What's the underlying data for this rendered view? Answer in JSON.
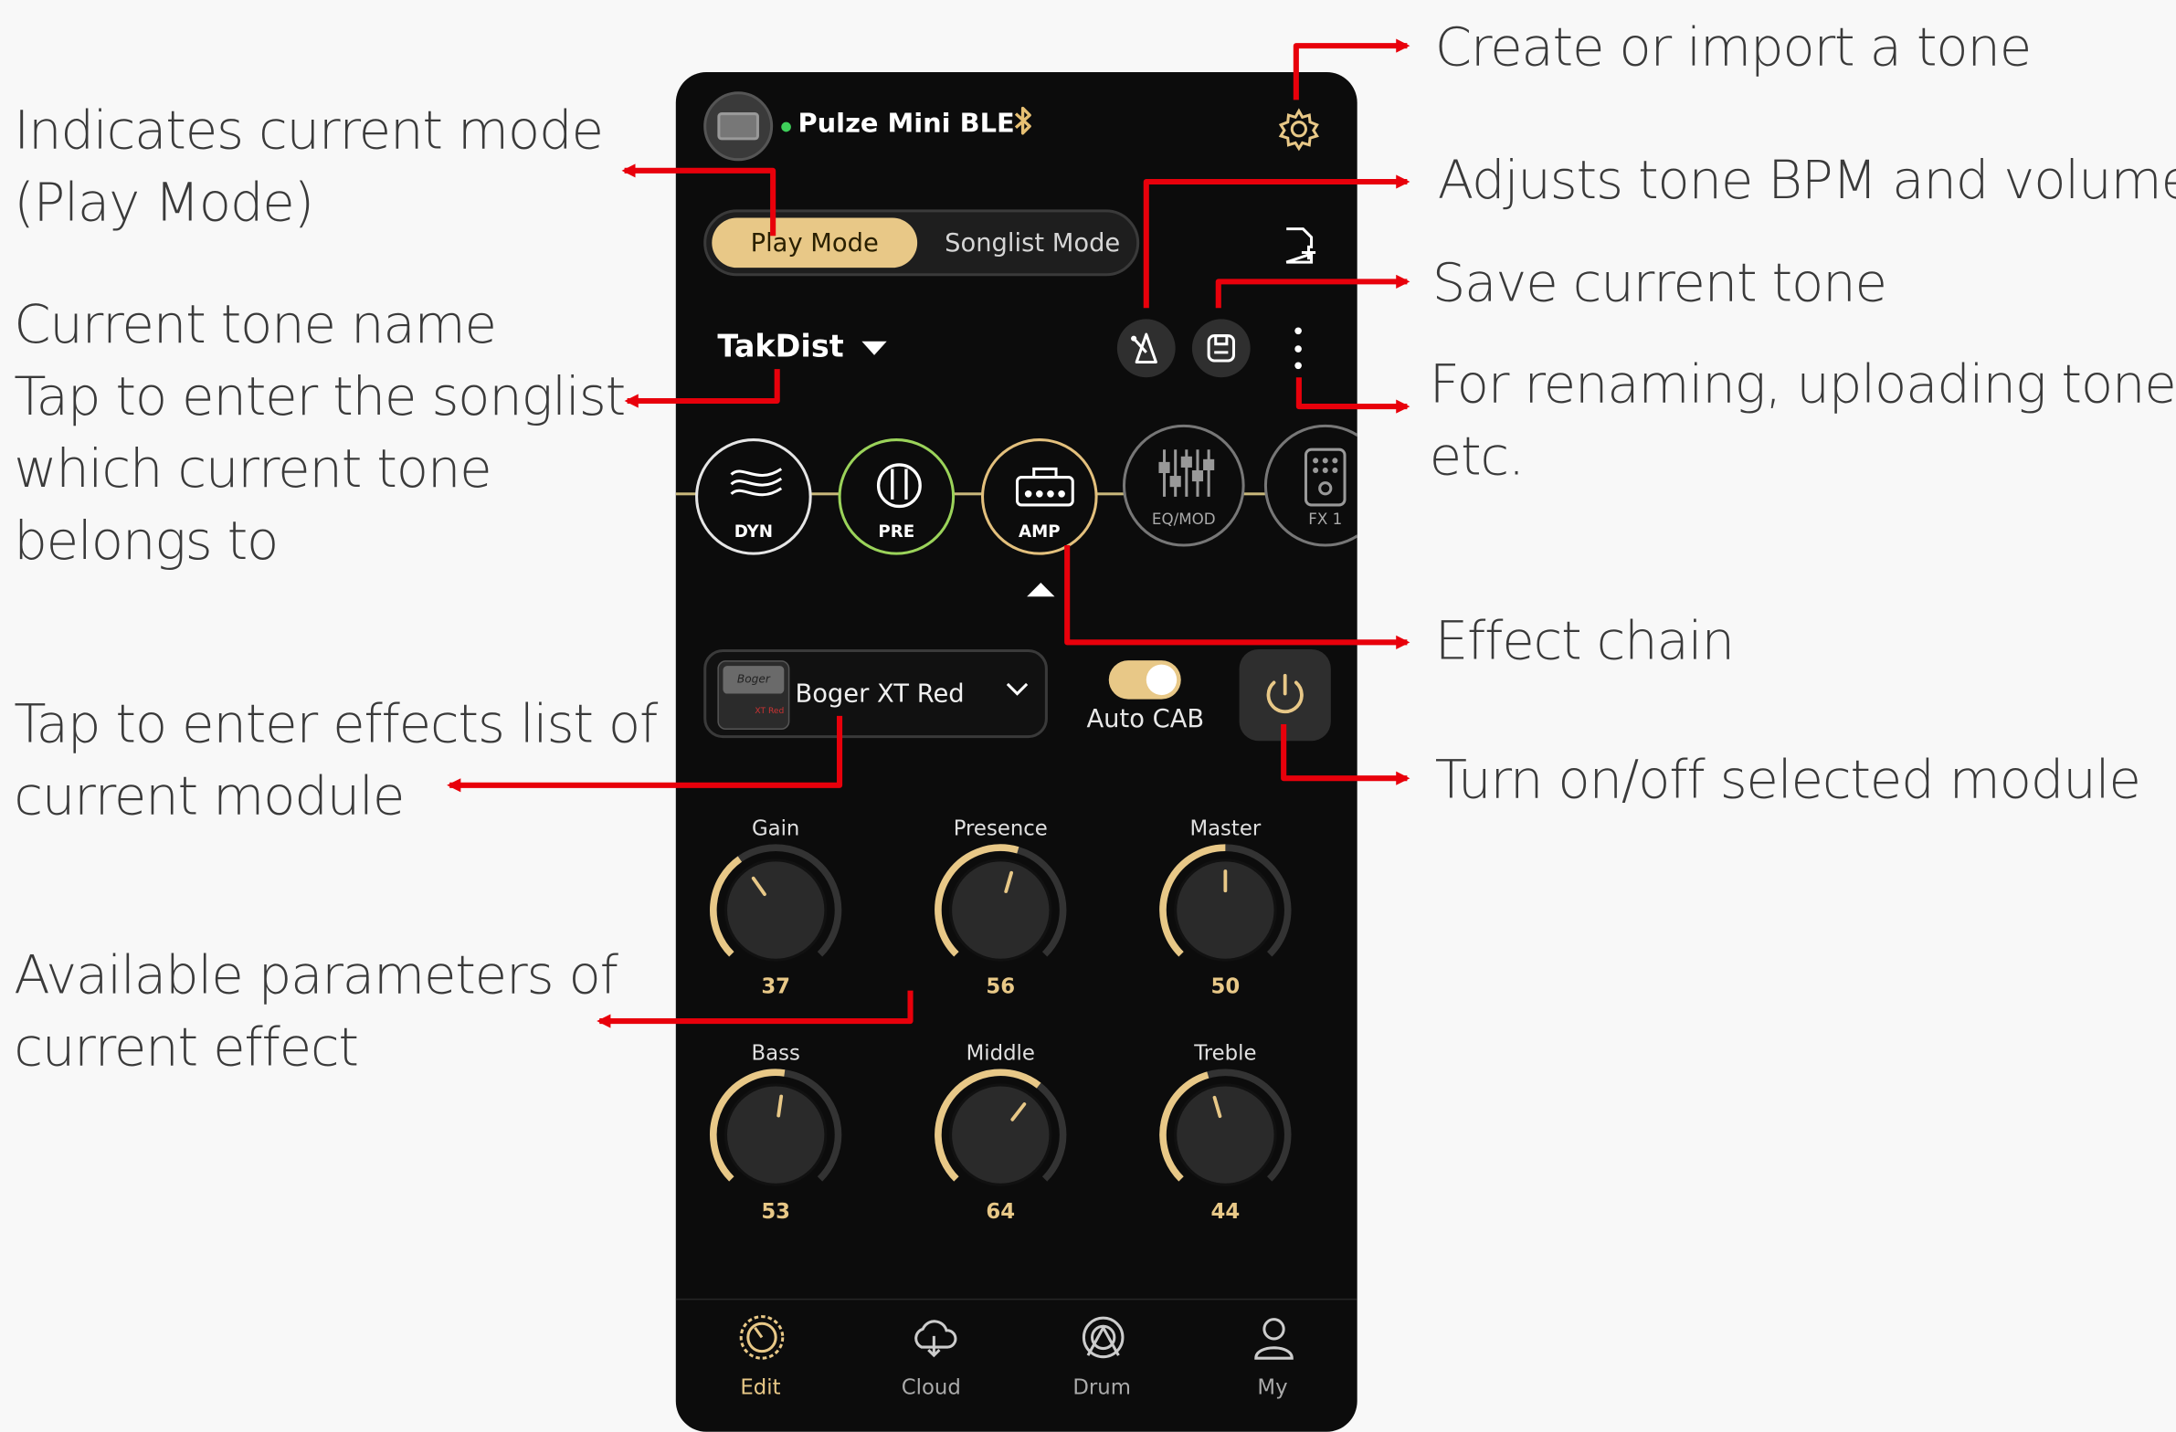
{
  "annotations": {
    "mode": [
      "Indicates current mode",
      "(Play Mode)"
    ],
    "tone_name": [
      "Current tone name",
      "Tap to enter the songlist",
      "which current tone",
      "belongs to"
    ],
    "effects_list": [
      "Tap to enter effects list of",
      "current module"
    ],
    "parameters": [
      "Available parameters of",
      "current effect"
    ],
    "create_tone": "Create or import a tone",
    "bpm_volume": "Adjusts tone BPM and volume",
    "save_tone": "Save current tone",
    "rename_upload": [
      "For renaming, uploading tones,",
      "etc."
    ],
    "effect_chain": "Effect chain",
    "power": "Turn on/off selected module"
  },
  "app": {
    "device_name": "Pulze Mini BLE",
    "bluetooth_icon": "bluetooth-icon",
    "settings_icon": "gear-icon",
    "modes": {
      "active": "Play Mode",
      "inactive": "Songlist Mode"
    },
    "tone": {
      "name": "TakDist"
    },
    "chain": [
      {
        "label": "DYN",
        "icon": "waves-icon",
        "state": "inactive"
      },
      {
        "label": "PRE",
        "icon": "preamp-icon",
        "state": "on"
      },
      {
        "label": "AMP",
        "icon": "amp-icon",
        "state": "selected"
      },
      {
        "label": "EQ/MOD",
        "icon": "eq-icon",
        "state": "off"
      },
      {
        "label": "FX 1",
        "icon": "pedal-icon",
        "state": "off"
      }
    ],
    "effect": {
      "name": "Boger XT Red",
      "thumb_text": "Boger",
      "thumb_badge": "XT Red"
    },
    "auto_cab": {
      "label": "Auto CAB",
      "on": true
    },
    "knobs": [
      {
        "label": "Gain",
        "value": "37"
      },
      {
        "label": "Presence",
        "value": "56"
      },
      {
        "label": "Master",
        "value": "50"
      },
      {
        "label": "Bass",
        "value": "53"
      },
      {
        "label": "Middle",
        "value": "64"
      },
      {
        "label": "Treble",
        "value": "44"
      }
    ],
    "tabs": [
      {
        "label": "Edit",
        "icon": "edit-dial-icon",
        "active": true
      },
      {
        "label": "Cloud",
        "icon": "cloud-icon",
        "active": false
      },
      {
        "label": "Drum",
        "icon": "drum-icon",
        "active": false
      },
      {
        "label": "My",
        "icon": "user-icon",
        "active": false
      }
    ],
    "colors": {
      "accent": "#e8c887",
      "arrow": "#e8000b",
      "pre_ring": "#9bd35a",
      "background": "#0c0c0c"
    }
  }
}
